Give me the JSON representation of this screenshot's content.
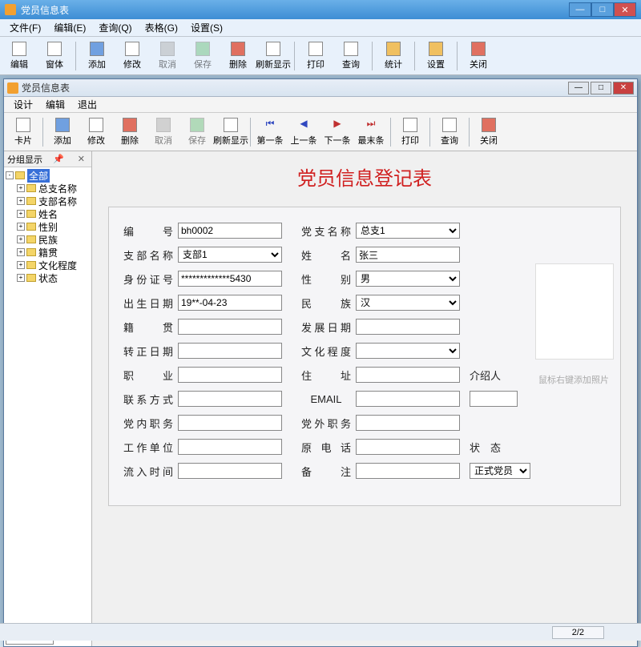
{
  "outer": {
    "title": "党员信息表",
    "menus": [
      "文件(F)",
      "编辑(E)",
      "查询(Q)",
      "表格(G)",
      "设置(S)"
    ],
    "toolbar": [
      {
        "label": "编辑",
        "icon": "edit-icon"
      },
      {
        "label": "窗体",
        "icon": "form-icon"
      },
      {
        "label": "添加",
        "icon": "add-icon"
      },
      {
        "label": "修改",
        "icon": "modify-icon"
      },
      {
        "label": "取消",
        "icon": "cancel-icon",
        "disabled": true
      },
      {
        "label": "保存",
        "icon": "save-icon",
        "disabled": true
      },
      {
        "label": "删除",
        "icon": "delete-icon"
      },
      {
        "label": "刷新显示",
        "icon": "refresh-icon"
      },
      {
        "label": "打印",
        "icon": "print-icon"
      },
      {
        "label": "查询",
        "icon": "search-icon"
      },
      {
        "label": "统计",
        "icon": "stats-icon"
      },
      {
        "label": "设置",
        "icon": "settings-icon"
      },
      {
        "label": "关闭",
        "icon": "close-icon"
      }
    ]
  },
  "inner": {
    "title": "党员信息表",
    "menus": [
      "设计",
      "编辑",
      "退出"
    ],
    "toolbar": [
      {
        "label": "卡片",
        "icon": "card-icon"
      },
      {
        "label": "添加",
        "icon": "add-icon"
      },
      {
        "label": "修改",
        "icon": "modify-icon"
      },
      {
        "label": "删除",
        "icon": "delete-icon"
      },
      {
        "label": "取消",
        "icon": "cancel-icon",
        "disabled": true
      },
      {
        "label": "保存",
        "icon": "save-icon",
        "disabled": true
      },
      {
        "label": "刷新显示",
        "icon": "refresh-icon"
      },
      {
        "label": "第一条",
        "icon": "first-icon"
      },
      {
        "label": "上一条",
        "icon": "prev-icon"
      },
      {
        "label": "下一条",
        "icon": "next-icon"
      },
      {
        "label": "最末条",
        "icon": "last-icon"
      },
      {
        "label": "打印",
        "icon": "print-icon"
      },
      {
        "label": "查询",
        "icon": "search-icon"
      },
      {
        "label": "关闭",
        "icon": "close-icon"
      }
    ]
  },
  "sidebar": {
    "header": "分组显示",
    "root": "全部",
    "items": [
      "总支名称",
      "支部名称",
      "姓名",
      "性别",
      "民族",
      "籍贯",
      "文化程度",
      "状态"
    ]
  },
  "form": {
    "title": "党员信息登记表",
    "photoHint": "鼠标右键添加照片",
    "labels": {
      "id": "编　号",
      "branchMain": "党支名称",
      "branchSub": "支部名称",
      "name": "姓　名",
      "idcard": "身份证号",
      "gender": "性　别",
      "birth": "出生日期",
      "nation": "民　族",
      "origin": "籍　贯",
      "devDate": "发展日期",
      "transDate": "转正日期",
      "edu": "文化程度",
      "job": "职　业",
      "addr": "住　址",
      "contact": "联系方式",
      "email": "EMAIL",
      "dutyIn": "党内职务",
      "dutyOut": "党外职务",
      "workUnit": "工作单位",
      "phone": "原电话",
      "inflow": "流入时间",
      "remark": "备　注",
      "intro": "介绍人",
      "status": "状　态"
    },
    "values": {
      "id": "bh0002",
      "branchMain": "总支1",
      "branchSub": "支部1",
      "name": "张三",
      "idcard": "*************5430",
      "gender": "男",
      "birth": "19**-04-23",
      "nation": "汉",
      "origin": "",
      "devDate": "",
      "transDate": "",
      "edu": "",
      "job": "",
      "addr": "",
      "contact": "",
      "email": "",
      "dutyIn": "",
      "dutyOut": "",
      "workUnit": "",
      "phone": "",
      "inflow": "",
      "remark": "",
      "intro": "",
      "status": "正式党员"
    }
  },
  "status": {
    "page": "2/2"
  }
}
